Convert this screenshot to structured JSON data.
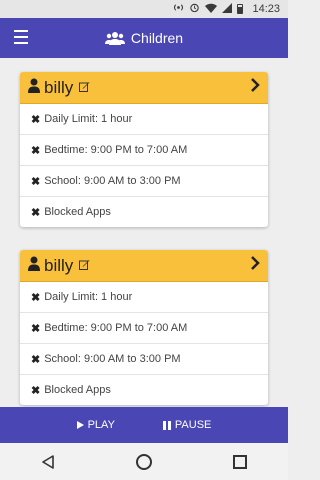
{
  "status_bar": {
    "time": "14:23",
    "icons": [
      "hotspot-icon",
      "alarm-icon",
      "wifi-icon",
      "signal-icon",
      "battery-icon"
    ]
  },
  "app_bar": {
    "title": "Children",
    "menu_icon": "hamburger-menu-icon",
    "title_icon": "group-icon"
  },
  "children": [
    {
      "name": "billy",
      "rules": [
        {
          "text": "Daily Limit: 1 hour"
        },
        {
          "text": "Bedtime: 9:00 PM to 7:00 AM"
        },
        {
          "text": "School: 9:00 AM to 3:00 PM"
        },
        {
          "text": "Blocked Apps"
        }
      ]
    },
    {
      "name": "billy",
      "rules": [
        {
          "text": "Daily Limit: 1 hour"
        },
        {
          "text": "Bedtime: 9:00 PM to 7:00 AM"
        },
        {
          "text": "School: 9:00 AM to 3:00 PM"
        },
        {
          "text": "Blocked Apps"
        }
      ]
    }
  ],
  "controls": {
    "play_label": "PLAY",
    "pause_label": "PAUSE"
  },
  "colors": {
    "app_bar": "#4a47b5",
    "card_header": "#f9c13b",
    "background": "#eeeeee"
  }
}
